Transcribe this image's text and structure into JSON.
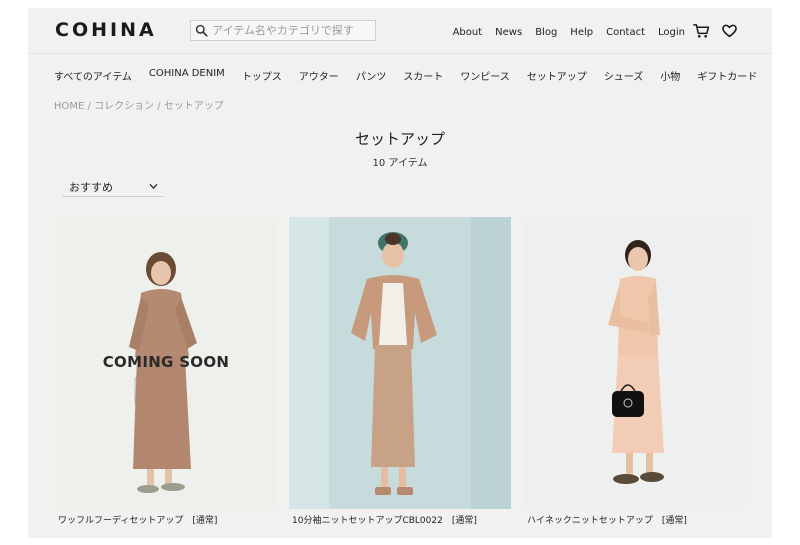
{
  "header": {
    "logo": "COHINA",
    "search_placeholder": "アイテム名やカテゴリで探す",
    "links": [
      "About",
      "News",
      "Blog",
      "Help",
      "Contact",
      "Login"
    ]
  },
  "categories": [
    "すべてのアイテム",
    "COHINA DENIM",
    "トップス",
    "アウター",
    "パンツ",
    "スカート",
    "ワンピース",
    "セットアップ",
    "シューズ",
    "小物",
    "ギフトカード"
  ],
  "breadcrumb": {
    "home": "HOME",
    "collection": "コレクション",
    "current": "セットアップ",
    "sep": " / "
  },
  "page": {
    "title": "セットアップ",
    "count": "10 アイテム"
  },
  "sort": {
    "selected": "おすすめ"
  },
  "products": [
    {
      "name": "ワッフルフーディセットアップ　[通常]",
      "overlay": "COMING SOON"
    },
    {
      "name": "10分袖ニットセットアップCBL0022　[通常]",
      "overlay": ""
    },
    {
      "name": "ハイネックニットセットアップ　[通常]",
      "overlay": ""
    }
  ],
  "colors": {
    "background": "#f2f1ef",
    "text": "#222222",
    "muted": "#9b9b9b"
  }
}
